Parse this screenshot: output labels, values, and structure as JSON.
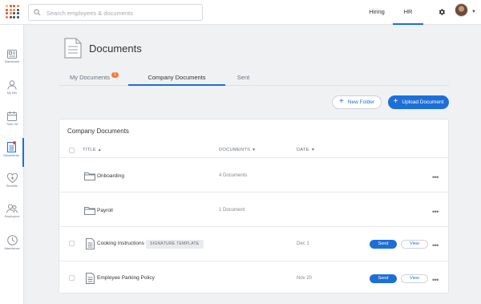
{
  "search": {
    "placeholder": "Search employees & documents"
  },
  "header": {
    "hiring_label": "Hiring",
    "hr_label": "HR"
  },
  "logo": {
    "dot_colors": [
      "#f1c232",
      "#e8453c",
      "#f37c3a",
      "#3b4757"
    ]
  },
  "sidebar": {
    "items": [
      {
        "label": "Dashboard",
        "icon": "dashboard-icon"
      },
      {
        "label": "My Info",
        "icon": "person-icon"
      },
      {
        "label": "Time Off",
        "icon": "calendar-icon"
      },
      {
        "label": "Documents",
        "icon": "document-icon",
        "active": true,
        "has_notification": true
      },
      {
        "label": "Benefits",
        "icon": "heart-plus-icon"
      },
      {
        "label": "Employees",
        "icon": "people-icon"
      },
      {
        "label": "Attendance",
        "icon": "clock-icon"
      }
    ]
  },
  "page": {
    "title": "Documents"
  },
  "tabs": [
    {
      "label": "My Documents",
      "badge": "1"
    },
    {
      "label": "Company Documents",
      "active": true
    },
    {
      "label": "Sent"
    }
  ],
  "actions": {
    "new_folder": "New Folder",
    "upload_document": "Upload Document"
  },
  "card": {
    "title": "Company Documents",
    "columns": {
      "title": "TITLE",
      "documents": "DOCUMENTS",
      "date": "DATE"
    },
    "rows": [
      {
        "type": "folder",
        "name": "Onboarding",
        "documents": "4 Documents"
      },
      {
        "type": "folder",
        "name": "Payroll",
        "documents": "1 Document"
      },
      {
        "type": "file",
        "name": "Cooking Instructions",
        "tag": "SIGNATURE TEMPLATE",
        "date": "Dec 1",
        "send": "Send",
        "view": "View"
      },
      {
        "type": "file",
        "name": "Employee Parking Policy",
        "date": "Nov 20",
        "send": "Send",
        "view": "View"
      }
    ]
  },
  "colors": {
    "accent": "#1d6fd8",
    "badge": "#f37c3a",
    "notification": "#e8453c"
  }
}
